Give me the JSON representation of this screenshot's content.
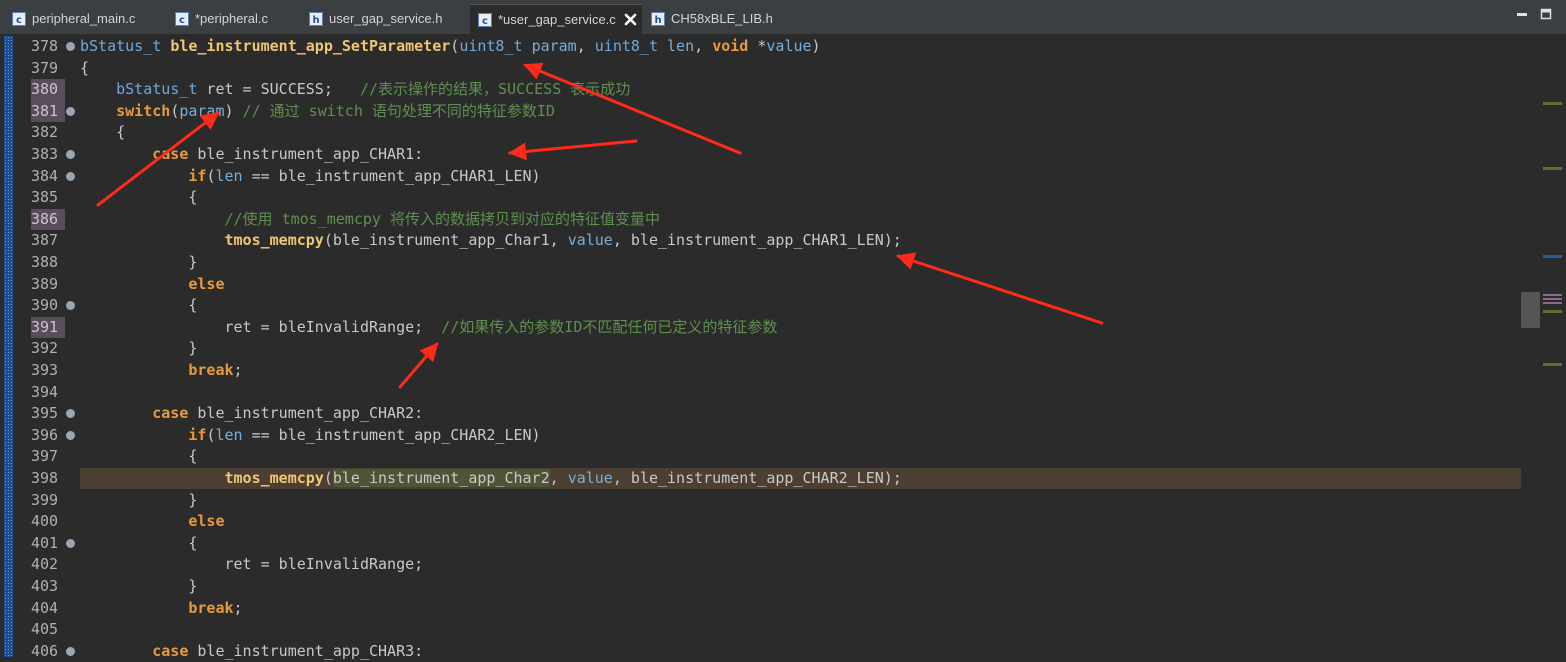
{
  "tabs": [
    {
      "label": "peripheral_main.c",
      "icon": "c-file-icon",
      "active": false
    },
    {
      "label": "*peripheral.c",
      "icon": "c-file-icon",
      "active": false
    },
    {
      "label": "user_gap_service.h",
      "icon": "h-file-icon",
      "active": false
    },
    {
      "label": "*user_gap_service.c",
      "icon": "c-file-icon",
      "active": true
    },
    {
      "label": "CH58xBLE_LIB.h",
      "icon": "h-file-icon",
      "active": false
    }
  ],
  "colors": {
    "background": "#2b2b2b",
    "keyword": "#e89a3c",
    "type": "#6fa8dc",
    "function": "#f0c674",
    "comment": "#5f8f4e",
    "annotation_arrow": "#ff2a1a"
  },
  "editor": {
    "lines": [
      {
        "num": "378",
        "fold": true,
        "mark": false,
        "parts": [
          [
            "t-type",
            "bStatus_t"
          ],
          [
            "t-ident",
            " "
          ],
          [
            "t-fn",
            "ble_instrument_app_SetParameter"
          ],
          [
            "t-ident",
            "("
          ],
          [
            "t-type",
            "uint8_t"
          ],
          [
            "t-ident",
            " "
          ],
          [
            "t-par",
            "param"
          ],
          [
            "t-ident",
            ", "
          ],
          [
            "t-type",
            "uint8_t"
          ],
          [
            "t-ident",
            " "
          ],
          [
            "t-par",
            "len"
          ],
          [
            "t-ident",
            ", "
          ],
          [
            "t-kw",
            "void"
          ],
          [
            "t-ident",
            " *"
          ],
          [
            "t-par",
            "value"
          ],
          [
            "t-ident",
            ")"
          ]
        ]
      },
      {
        "num": "379",
        "fold": false,
        "mark": false,
        "parts": [
          [
            "t-ident",
            "{"
          ]
        ]
      },
      {
        "num": "380",
        "fold": false,
        "mark": true,
        "parts": [
          [
            "t-ident",
            "    "
          ],
          [
            "t-type",
            "bStatus_t"
          ],
          [
            "t-ident",
            " ret = SUCCESS;   "
          ],
          [
            "t-cmt",
            "//表示操作的结果，SUCCESS 表示成功"
          ]
        ]
      },
      {
        "num": "381",
        "fold": true,
        "mark": true,
        "parts": [
          [
            "t-ident",
            "    "
          ],
          [
            "t-kw",
            "switch"
          ],
          [
            "t-ident",
            "("
          ],
          [
            "t-par",
            "param"
          ],
          [
            "t-ident",
            ") "
          ],
          [
            "t-cmt",
            "// 通过 switch 语句处理不同的特征参数ID"
          ]
        ]
      },
      {
        "num": "382",
        "fold": false,
        "mark": false,
        "parts": [
          [
            "t-ident",
            "    {"
          ]
        ]
      },
      {
        "num": "383",
        "fold": true,
        "mark": false,
        "parts": [
          [
            "t-ident",
            "        "
          ],
          [
            "t-kw",
            "case"
          ],
          [
            "t-ident",
            " ble_instrument_app_CHAR1:"
          ]
        ]
      },
      {
        "num": "384",
        "fold": true,
        "mark": false,
        "parts": [
          [
            "t-ident",
            "            "
          ],
          [
            "t-kw",
            "if"
          ],
          [
            "t-ident",
            "("
          ],
          [
            "t-par",
            "len"
          ],
          [
            "t-ident",
            " == ble_instrument_app_CHAR1_LEN)"
          ]
        ]
      },
      {
        "num": "385",
        "fold": false,
        "mark": false,
        "parts": [
          [
            "t-ident",
            "            {"
          ]
        ]
      },
      {
        "num": "386",
        "fold": false,
        "mark": true,
        "parts": [
          [
            "t-ident",
            "                "
          ],
          [
            "t-cmt",
            "//使用 tmos_memcpy 将传入的数据拷贝到对应的特征值变量中"
          ]
        ]
      },
      {
        "num": "387",
        "fold": false,
        "mark": false,
        "parts": [
          [
            "t-ident",
            "                "
          ],
          [
            "t-fn",
            "tmos_memcpy"
          ],
          [
            "t-ident",
            "(ble_instrument_app_Char1, "
          ],
          [
            "t-par",
            "value"
          ],
          [
            "t-ident",
            ", ble_instrument_app_CHAR1_LEN);"
          ]
        ]
      },
      {
        "num": "388",
        "fold": false,
        "mark": false,
        "parts": [
          [
            "t-ident",
            "            }"
          ]
        ]
      },
      {
        "num": "389",
        "fold": false,
        "mark": false,
        "parts": [
          [
            "t-ident",
            "            "
          ],
          [
            "t-kw",
            "else"
          ]
        ]
      },
      {
        "num": "390",
        "fold": true,
        "mark": false,
        "parts": [
          [
            "t-ident",
            "            {"
          ]
        ]
      },
      {
        "num": "391",
        "fold": false,
        "mark": true,
        "parts": [
          [
            "t-ident",
            "                ret = bleInvalidRange;  "
          ],
          [
            "t-cmt",
            "//如果传入的参数ID不匹配任何已定义的特征参数"
          ]
        ]
      },
      {
        "num": "392",
        "fold": false,
        "mark": false,
        "parts": [
          [
            "t-ident",
            "            }"
          ]
        ]
      },
      {
        "num": "393",
        "fold": false,
        "mark": false,
        "parts": [
          [
            "t-ident",
            "            "
          ],
          [
            "t-kw",
            "break"
          ],
          [
            "t-ident",
            ";"
          ]
        ]
      },
      {
        "num": "394",
        "fold": false,
        "mark": false,
        "parts": [
          [
            "t-ident",
            ""
          ]
        ]
      },
      {
        "num": "395",
        "fold": true,
        "mark": false,
        "parts": [
          [
            "t-ident",
            "        "
          ],
          [
            "t-kw",
            "case"
          ],
          [
            "t-ident",
            " ble_instrument_app_CHAR2:"
          ]
        ]
      },
      {
        "num": "396",
        "fold": true,
        "mark": false,
        "parts": [
          [
            "t-ident",
            "            "
          ],
          [
            "t-kw",
            "if"
          ],
          [
            "t-ident",
            "("
          ],
          [
            "t-par",
            "len"
          ],
          [
            "t-ident",
            " == ble_instrument_app_CHAR2_LEN)"
          ]
        ]
      },
      {
        "num": "397",
        "fold": false,
        "mark": false,
        "parts": [
          [
            "t-ident",
            "            {"
          ]
        ]
      },
      {
        "num": "398",
        "fold": false,
        "mark": false,
        "current": true,
        "parts": [
          [
            "t-ident",
            "                "
          ],
          [
            "t-fn",
            "tmos_memcpy"
          ],
          [
            "t-ident",
            "("
          ],
          [
            "t-ident t-hl",
            "ble_instrument_app_Char2"
          ],
          [
            "t-ident",
            ", "
          ],
          [
            "t-par",
            "value"
          ],
          [
            "t-ident",
            ", ble_instrument_app_CHAR2_LEN);"
          ]
        ]
      },
      {
        "num": "399",
        "fold": false,
        "mark": false,
        "parts": [
          [
            "t-ident",
            "            }"
          ]
        ]
      },
      {
        "num": "400",
        "fold": false,
        "mark": false,
        "parts": [
          [
            "t-ident",
            "            "
          ],
          [
            "t-kw",
            "else"
          ]
        ]
      },
      {
        "num": "401",
        "fold": true,
        "mark": false,
        "parts": [
          [
            "t-ident",
            "            {"
          ]
        ]
      },
      {
        "num": "402",
        "fold": false,
        "mark": false,
        "parts": [
          [
            "t-ident",
            "                ret = bleInvalidRange;"
          ]
        ]
      },
      {
        "num": "403",
        "fold": false,
        "mark": false,
        "parts": [
          [
            "t-ident",
            "            }"
          ]
        ]
      },
      {
        "num": "404",
        "fold": false,
        "mark": false,
        "parts": [
          [
            "t-ident",
            "            "
          ],
          [
            "t-kw",
            "break"
          ],
          [
            "t-ident",
            ";"
          ]
        ]
      },
      {
        "num": "405",
        "fold": false,
        "mark": false,
        "parts": [
          [
            "t-ident",
            ""
          ]
        ]
      },
      {
        "num": "406",
        "fold": true,
        "mark": false,
        "parts": [
          [
            "t-ident",
            "        "
          ],
          [
            "t-kw",
            "case"
          ],
          [
            "t-ident",
            " ble_instrument_app_CHAR3:"
          ]
        ]
      }
    ]
  }
}
